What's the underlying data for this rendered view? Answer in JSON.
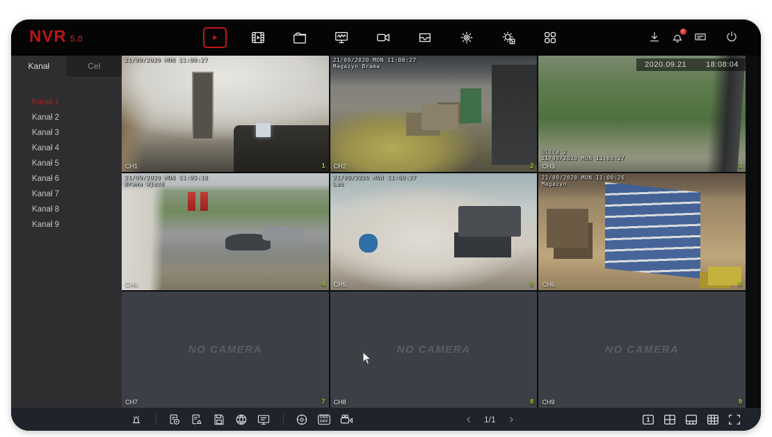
{
  "window": {
    "brand": "NVR",
    "version": "5.0"
  },
  "top_nav": {
    "active": "live-view",
    "icons": [
      "live-view",
      "playback",
      "file-manager",
      "system-overview",
      "camera-manage",
      "storage-manage",
      "settings",
      "maintenance",
      "apps-grid"
    ]
  },
  "top_right_icons": [
    "download",
    "alarm-notification",
    "recorder-device",
    "power"
  ],
  "sidebar": {
    "tab_channel": "Kanał",
    "tab_target": "Cel",
    "channels": [
      {
        "label": "Kanał 1",
        "selected": true
      },
      {
        "label": "Kanał 2"
      },
      {
        "label": "Kanał 3"
      },
      {
        "label": "Kanał 4"
      },
      {
        "label": "Kanał 5"
      },
      {
        "label": "Kanał 6"
      },
      {
        "label": "Kanał 7"
      },
      {
        "label": "Kanał 8"
      },
      {
        "label": "Kanał 9"
      }
    ]
  },
  "grid": {
    "cells": [
      {
        "ch": "CH1",
        "num": "1",
        "osd_time": "21/09/2020 MON 11:00:27",
        "osd_name": ""
      },
      {
        "ch": "CH2",
        "num": "2",
        "osd_time": "21/09/2020 MON 11:00:27",
        "osd_name": "Magazyn Brama"
      },
      {
        "ch": "CH3",
        "num": "3",
        "osd_time": "21/09/2020 MON 11:00:27",
        "osd_name": "Ulica 2",
        "badge_date": "2020.09.21",
        "badge_time": "18:08:04"
      },
      {
        "ch": "CH4",
        "num": "4",
        "osd_time": "21/09/2020 MON 11:05:18",
        "osd_name": "Brama Wjazd"
      },
      {
        "ch": "CH5",
        "num": "5",
        "osd_time": "21/09/2020 MON 11:00:27",
        "osd_name": "Lab"
      },
      {
        "ch": "CH6",
        "num": "6",
        "osd_time": "21/09/2020 MON 11:00:26",
        "osd_name": "Magazyn"
      },
      {
        "ch": "CH7",
        "num": "7",
        "no_camera": "NO CAMERA"
      },
      {
        "ch": "CH8",
        "num": "8",
        "no_camera": "NO CAMERA"
      },
      {
        "ch": "CH9",
        "num": "9",
        "no_camera": "NO CAMERA"
      }
    ]
  },
  "bottom_bar": {
    "icons": [
      "alarm-siren",
      "manual-record",
      "alarm-status",
      "disk-backup",
      "network",
      "osd-menu",
      "ptz-control",
      "osd-off",
      "video-talk"
    ],
    "osd_off": {
      "line1": "OSD",
      "line2": "OFF"
    },
    "pagination": {
      "page": "1/1"
    },
    "layout_icons": [
      "view-single",
      "view-quad",
      "view-six",
      "view-nine",
      "fullscreen"
    ],
    "view_single_label": "1"
  },
  "colors": {
    "accent_red": "#c01818",
    "selected_channel": "#b01d22",
    "index_green": "#9ccf35"
  }
}
